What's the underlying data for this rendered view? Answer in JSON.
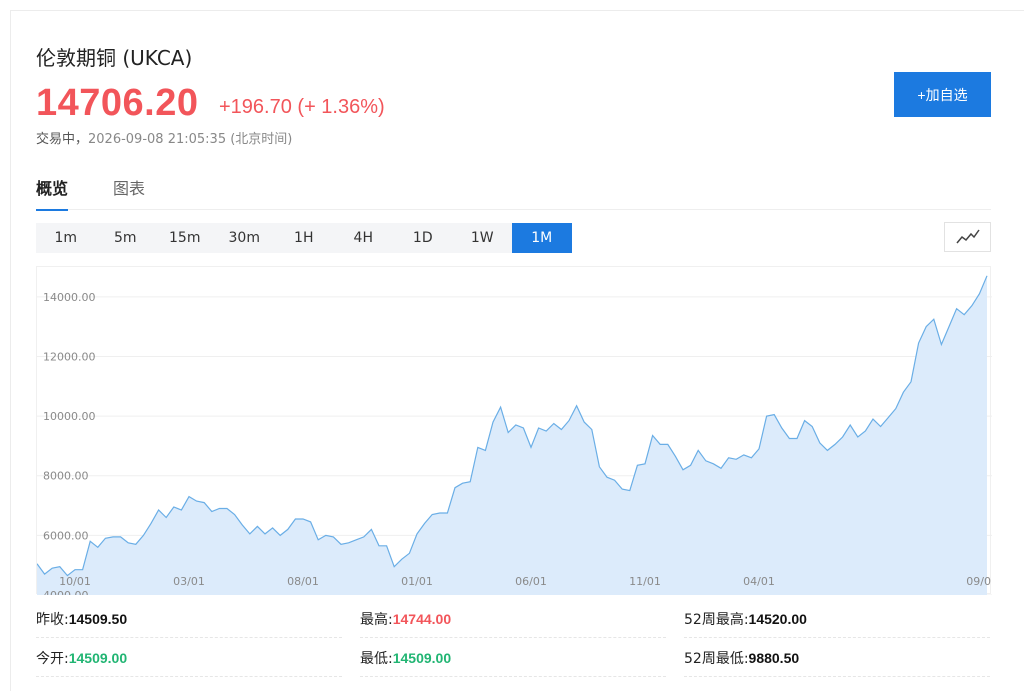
{
  "quote": {
    "title": "伦敦期铜 (UKCA)",
    "price": "14706.20",
    "change": "+196.70 (+ 1.36%)",
    "status_label": "交易中，",
    "timestamp": "2026-09-08 21:05:35 (北京时间)",
    "add_button": "+加自选"
  },
  "tabs": [
    {
      "label": "概览",
      "active": true
    },
    {
      "label": "图表",
      "active": false
    }
  ],
  "periods": [
    {
      "label": "1m"
    },
    {
      "label": "5m"
    },
    {
      "label": "15m"
    },
    {
      "label": "30m"
    },
    {
      "label": "1H"
    },
    {
      "label": "4H"
    },
    {
      "label": "1D"
    },
    {
      "label": "1W"
    },
    {
      "label": "1M",
      "active": true
    }
  ],
  "line_toggle_icon": "line-chart-icon",
  "colors": {
    "accent": "#1c7ae0",
    "up": "#f2555a",
    "down": "#21b573",
    "area": "#dcebfb",
    "line": "#6aaee6"
  },
  "stats": {
    "prev_close_label": "昨收:",
    "prev_close": "14509.50",
    "high_label": "最高:",
    "high": "14744.00",
    "wk52_high_label": "52周最高:",
    "wk52_high": "14520.00",
    "open_label": "今开:",
    "open": "14509.00",
    "low_label": "最低:",
    "low": "14509.00",
    "wk52_low_label": "52周最低:",
    "wk52_low": "9880.50"
  },
  "chart_data": {
    "type": "area",
    "ylim": [
      4000,
      15000
    ],
    "y_ticks": [
      "14000.00",
      "12000.00",
      "10000.00",
      "8000.00",
      "6000.00",
      "4000.00"
    ],
    "y_tick_values": [
      14000,
      12000,
      10000,
      8000,
      6000,
      4000
    ],
    "x_ticks": [
      "10/01",
      "03/01",
      "08/01",
      "01/01",
      "06/01",
      "11/01",
      "04/01",
      "09/0"
    ],
    "x_tick_index": [
      5,
      20,
      35,
      50,
      65,
      80,
      95,
      110
    ],
    "values": [
      5050,
      4700,
      4900,
      4950,
      4650,
      4850,
      4850,
      5800,
      5600,
      5900,
      5950,
      5950,
      5750,
      5700,
      6000,
      6400,
      6850,
      6600,
      6950,
      6850,
      7300,
      7150,
      7100,
      6800,
      6900,
      6900,
      6700,
      6350,
      6050,
      6300,
      6050,
      6250,
      6000,
      6200,
      6550,
      6550,
      6450,
      5850,
      6000,
      5950,
      5700,
      5750,
      5850,
      5950,
      6200,
      5650,
      5650,
      4950,
      5200,
      5400,
      6050,
      6400,
      6700,
      6750,
      6750,
      7600,
      7750,
      7800,
      8950,
      8850,
      9800,
      10300,
      9450,
      9700,
      9600,
      8950,
      9600,
      9500,
      9750,
      9550,
      9850,
      10350,
      9800,
      9550,
      8300,
      7950,
      7850,
      7550,
      7500,
      8350,
      8400,
      9350,
      9050,
      9050,
      8650,
      8200,
      8350,
      8850,
      8500,
      8400,
      8250,
      8600,
      8550,
      8700,
      8600,
      8900,
      10000,
      10050,
      9600,
      9250,
      9250,
      9850,
      9650,
      9100,
      8850,
      9050,
      9300,
      9700,
      9300,
      9500,
      9900,
      9650,
      9950,
      10250,
      10800,
      11150,
      12450,
      13000,
      13250,
      12400,
      13000,
      13600,
      13400,
      13700,
      14100,
      14706
    ]
  }
}
